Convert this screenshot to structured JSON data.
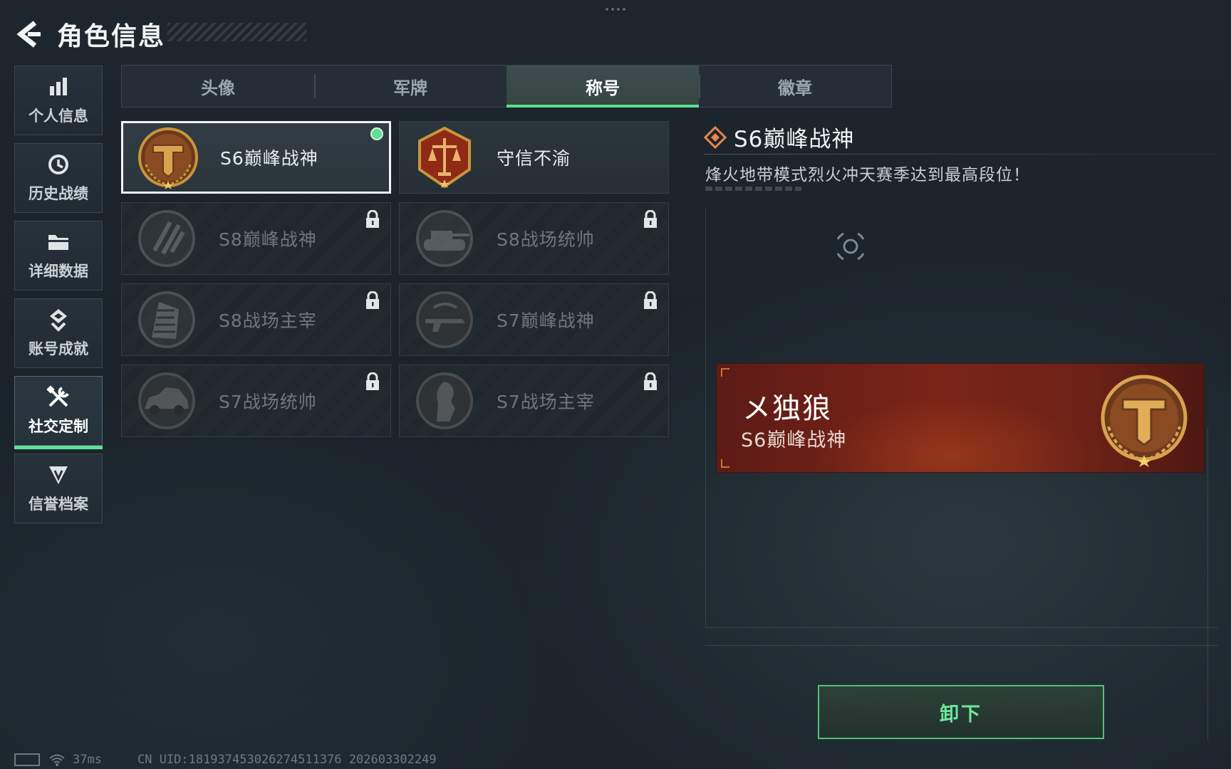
{
  "header": {
    "title": "角色信息"
  },
  "sidebar": {
    "items": [
      {
        "label": "个人信息",
        "icon": "bar-chart-icon"
      },
      {
        "label": "历史战绩",
        "icon": "history-icon"
      },
      {
        "label": "详细数据",
        "icon": "folder-icon"
      },
      {
        "label": "账号成就",
        "icon": "achievement-icon"
      },
      {
        "label": "社交定制",
        "icon": "tools-icon",
        "active": true
      },
      {
        "label": "信誉档案",
        "icon": "credit-icon"
      }
    ]
  },
  "tabs": [
    {
      "label": "头像"
    },
    {
      "label": "军牌"
    },
    {
      "label": "称号",
      "active": true
    },
    {
      "label": "徽章"
    }
  ],
  "titles": [
    {
      "name": "S6巅峰战神",
      "icon": "hammer-emblem-icon",
      "locked": false,
      "selected": true,
      "equipped": true
    },
    {
      "name": "守信不渝",
      "icon": "scales-emblem-icon",
      "locked": false,
      "selected": false
    },
    {
      "name": "S8巅峰战神",
      "icon": "slash-emblem-icon",
      "locked": true
    },
    {
      "name": "S8战场统帅",
      "icon": "tank-emblem-icon",
      "locked": true
    },
    {
      "name": "S8战场主宰",
      "icon": "building-emblem-icon",
      "locked": true
    },
    {
      "name": "S7巅峰战神",
      "icon": "gun-emblem-icon",
      "locked": true
    },
    {
      "name": "S7战场统帅",
      "icon": "vehicle-emblem-icon",
      "locked": true
    },
    {
      "name": "S7战场主宰",
      "icon": "soldier-emblem-icon",
      "locked": true
    }
  ],
  "detail": {
    "title": "S6巅峰战神",
    "description": "烽火地带模式烈火冲天赛季达到最高段位！"
  },
  "nameplate": {
    "player_name": "メ独狼",
    "title": "S6巅峰战神"
  },
  "actions": {
    "unequip_label": "卸下"
  },
  "footer": {
    "ping": "37ms",
    "uid": "CN UID:18193745302627451137​6 202603302249"
  },
  "colors": {
    "accent": "#5fdf9a",
    "nameplate": "#7a2418",
    "gold": "#c8953c"
  }
}
